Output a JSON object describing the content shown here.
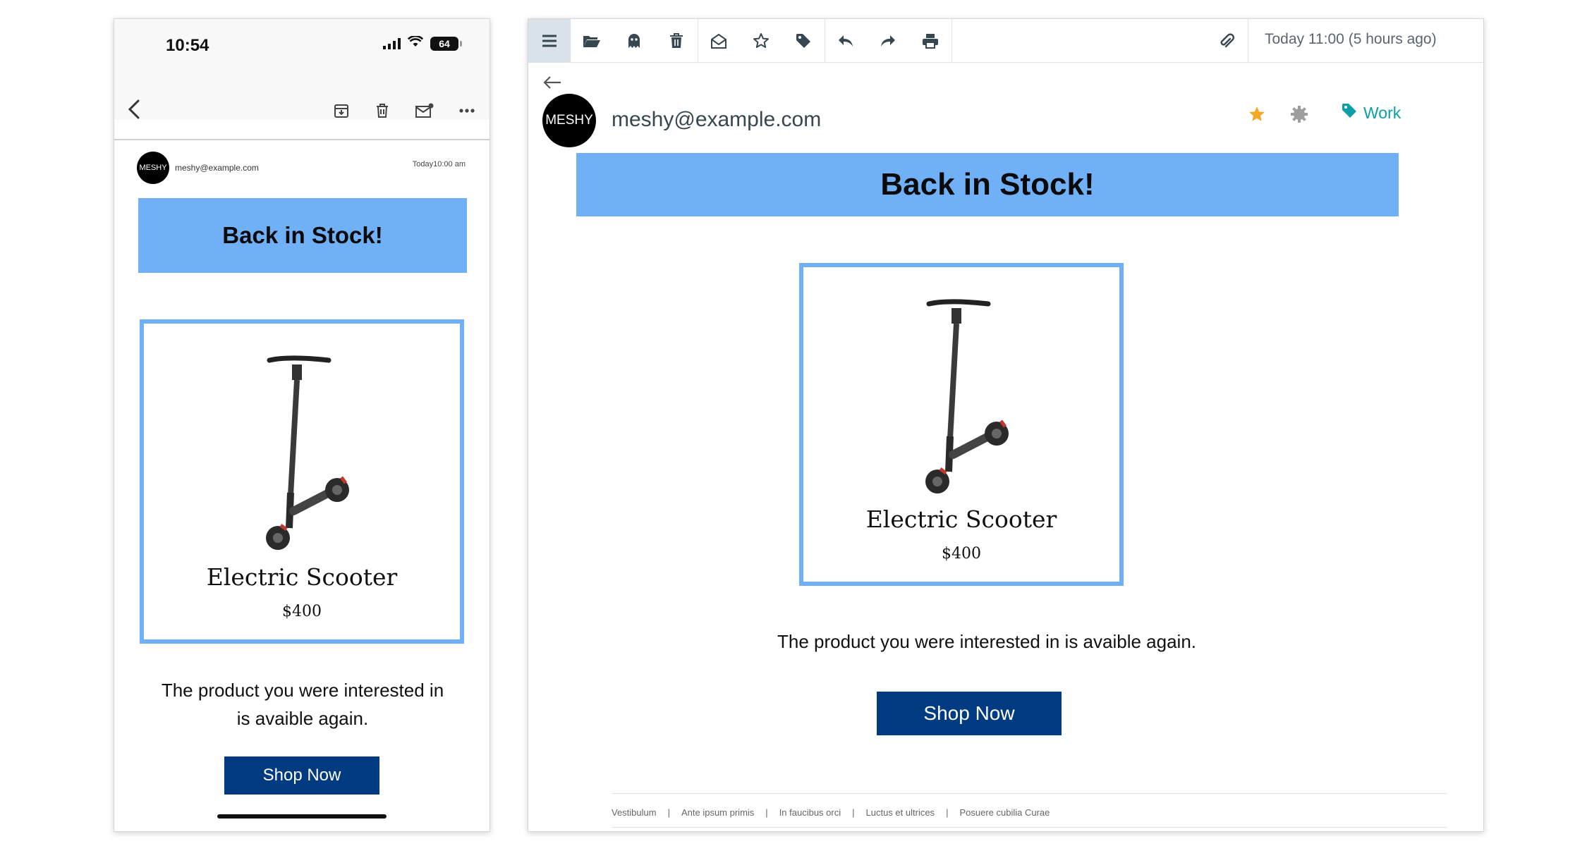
{
  "mobile": {
    "status": {
      "time": "10:54",
      "battery": "64"
    },
    "sender": "meshy@example.com",
    "avatar_label": "MESHY",
    "date": "Today10:00 am",
    "banner": "Back in Stock!",
    "product": {
      "name": "Electric Scooter",
      "price": "$400"
    },
    "message": "The product you were interested in is avaible again.",
    "cta": "Shop Now"
  },
  "desktop": {
    "toolbar": {
      "date": "Today 11:00 (5 hours ago)"
    },
    "avatar_label": "MESHY",
    "sender": "meshy@example.com",
    "tag": "Work",
    "banner": "Back in Stock!",
    "product": {
      "name": "Electric Scooter",
      "price": "$400"
    },
    "message": "The product you were interested in is avaible again.",
    "cta": "Shop Now",
    "footer_links": [
      "Vestibulum",
      "Ante ipsum primis",
      "In faucibus orci",
      "Luctus et ultrices",
      "Posuere cubilia Curae"
    ]
  },
  "colors": {
    "banner": "#6fb0f7",
    "button": "#003a80",
    "tag": "#0c9fa8",
    "star": "#f5a623"
  }
}
